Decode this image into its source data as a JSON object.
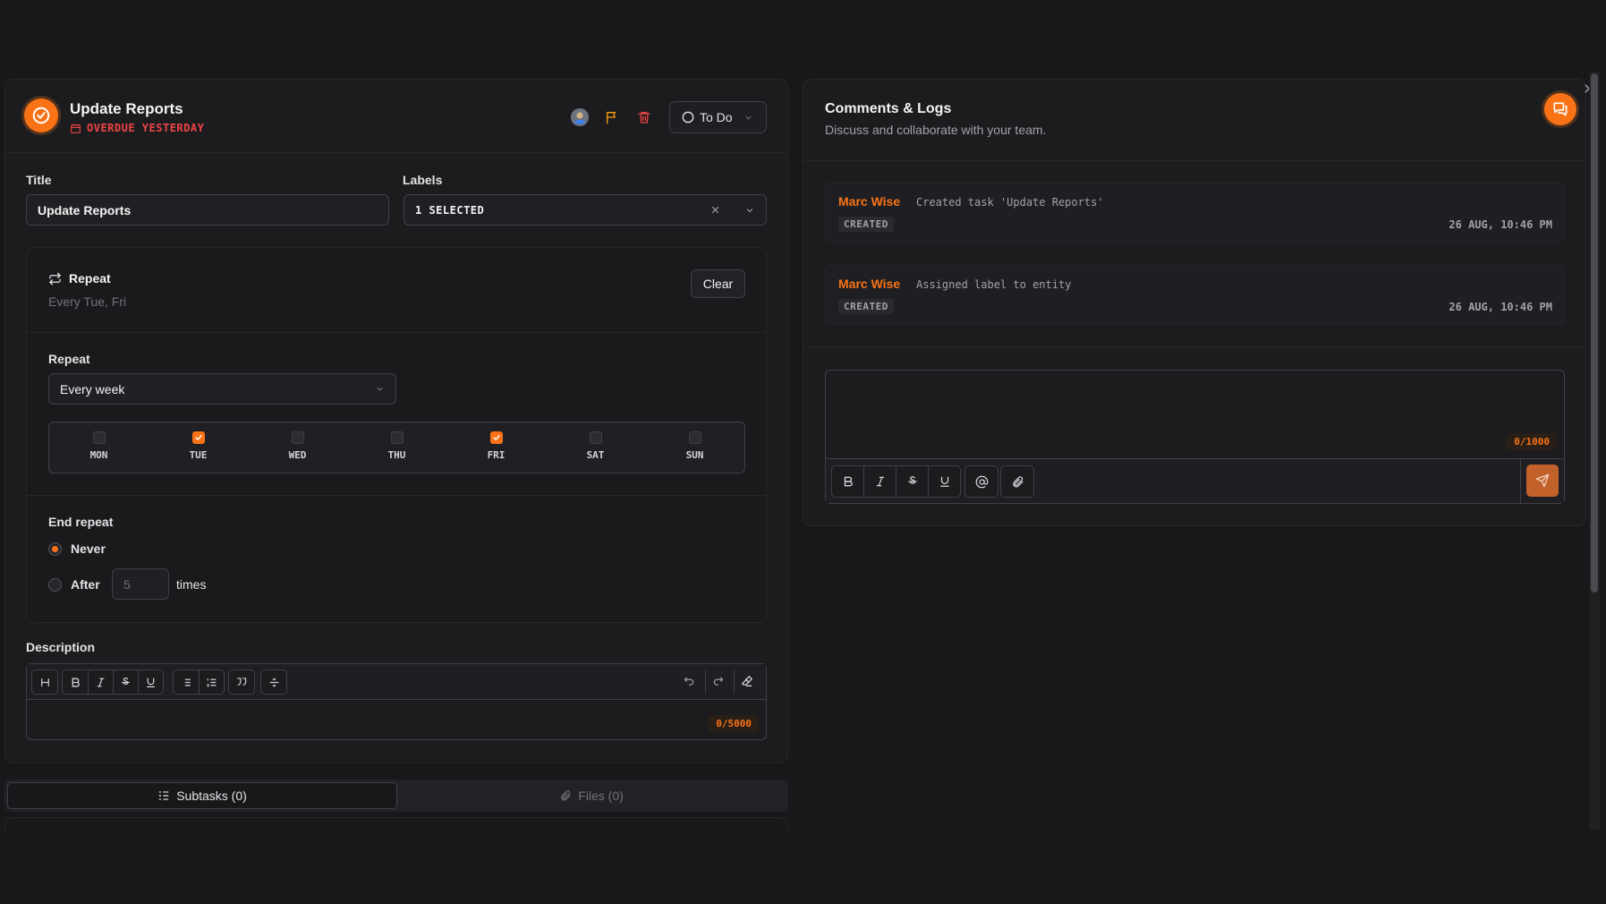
{
  "task": {
    "title": "Update Reports",
    "overdue": "OVERDUE YESTERDAY",
    "status": "To Do"
  },
  "form": {
    "title_label": "Title",
    "title_value": "Update Reports",
    "labels_label": "Labels",
    "labels_value": "1 SELECTED"
  },
  "repeat": {
    "heading": "Repeat",
    "summary": "Every Tue, Fri",
    "clear_label": "Clear",
    "select_label": "Repeat",
    "select_value": "Every week",
    "days": [
      {
        "label": "MON",
        "checked": false
      },
      {
        "label": "TUE",
        "checked": true
      },
      {
        "label": "WED",
        "checked": false
      },
      {
        "label": "THU",
        "checked": false
      },
      {
        "label": "FRI",
        "checked": true
      },
      {
        "label": "SAT",
        "checked": false
      },
      {
        "label": "SUN",
        "checked": false
      }
    ],
    "end_label": "End repeat",
    "never_label": "Never",
    "after_label": "After",
    "after_count_placeholder": "5",
    "times_label": "times"
  },
  "description": {
    "label": "Description",
    "counter": "0/5000"
  },
  "tabs": {
    "subtasks": "Subtasks (0)",
    "files": "Files (0)"
  },
  "comments": {
    "title": "Comments & Logs",
    "subtitle": "Discuss and collaborate with your team.",
    "counter": "0/1000",
    "logs": [
      {
        "user": "Marc Wise",
        "message": "Created task 'Update Reports'",
        "tag": "CREATED",
        "time": "26 AUG, 10:46 PM"
      },
      {
        "user": "Marc Wise",
        "message": "Assigned label to entity",
        "tag": "CREATED",
        "time": "26 AUG, 10:46 PM"
      }
    ]
  },
  "colors": {
    "accent": "#f97316",
    "danger": "#ef4444",
    "background": "#18181b"
  }
}
